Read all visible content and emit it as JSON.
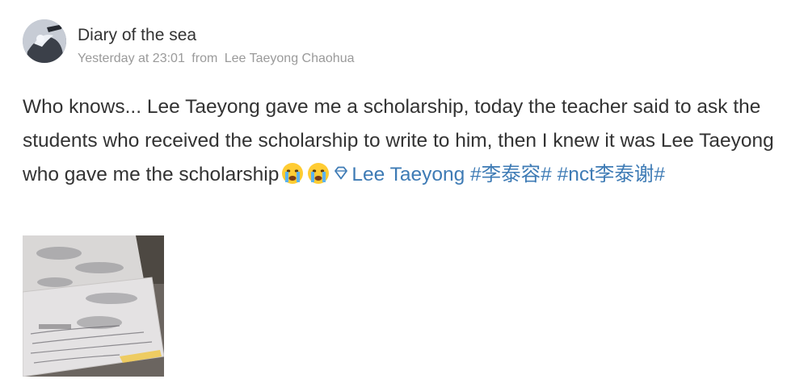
{
  "post": {
    "author": {
      "name": "Diary of the sea",
      "avatar_icon": "avatar-image"
    },
    "meta": {
      "time": "Yesterday at 23:01",
      "source_prefix": "from",
      "source": "Lee Taeyong Chaohua"
    },
    "body": {
      "text": "Who knows... Lee Taeyong gave me a scholarship, today the teacher said to ask the students who received the scholarship to write to him, then I knew it was Lee Taeyong who gave me the scholarship",
      "emojis": [
        "crying-face-emoji",
        "crying-face-emoji"
      ],
      "supertopic_icon": "diamond-icon",
      "supertopic_link": "Lee Taeyong",
      "hashtags": [
        "#李泰容#",
        "#nct李泰谢#"
      ]
    },
    "image": {
      "icon": "photo-thumbnail"
    },
    "colors": {
      "link": "#3e7bb5",
      "meta": "#9a9a9a",
      "text": "#333333"
    }
  }
}
